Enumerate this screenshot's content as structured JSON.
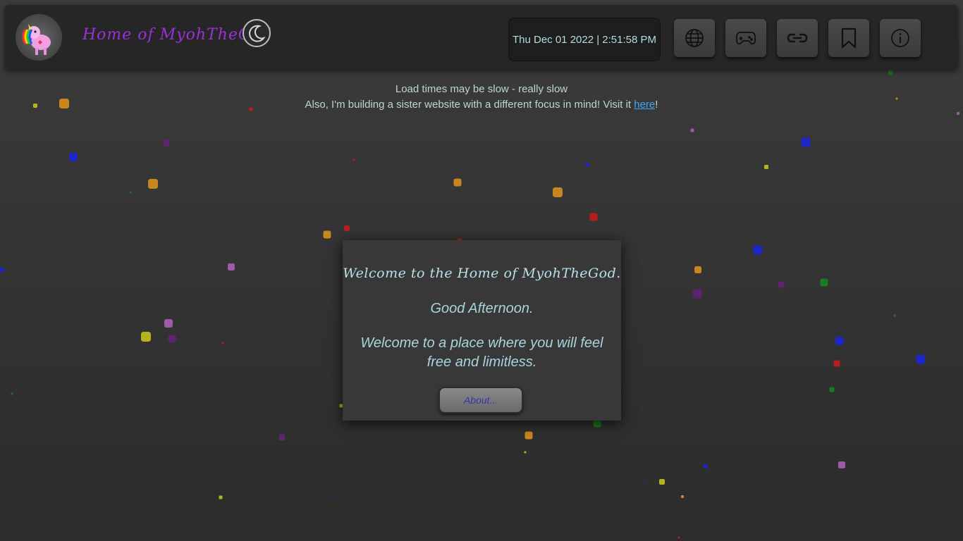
{
  "header": {
    "site_title": "Home of MyohTheGod",
    "datetime": "Thu Dec 01 2022 | 2:51:58 PM",
    "nav_buttons": [
      "globe-icon",
      "gamepad-icon",
      "link-icon",
      "bookmark-icon",
      "info-icon"
    ]
  },
  "notice": {
    "line1": "Load times may be slow - really slow",
    "line2_prefix": "Also, I'm building a sister website with a different focus in mind! Visit it ",
    "line2_link": "here",
    "line2_suffix": "!"
  },
  "card": {
    "title": "Welcome to the Home of MyohTheGod.",
    "greeting": "Good Afternoon.",
    "tagline": "Welcome to a place where you will feel free and limitless.",
    "about_label": "About..."
  },
  "colors": {
    "title_purple": "#9b30d9",
    "link_blue": "#3aa8ff",
    "particle_orange": "#c8861f",
    "particle_blue": "#1f26c8",
    "particle_red": "#b81c1c",
    "particle_yellow": "#b4b41e",
    "particle_purple": "#5e236e",
    "particle_pink": "#9e5ca8",
    "particle_green": "#1c7a20"
  }
}
